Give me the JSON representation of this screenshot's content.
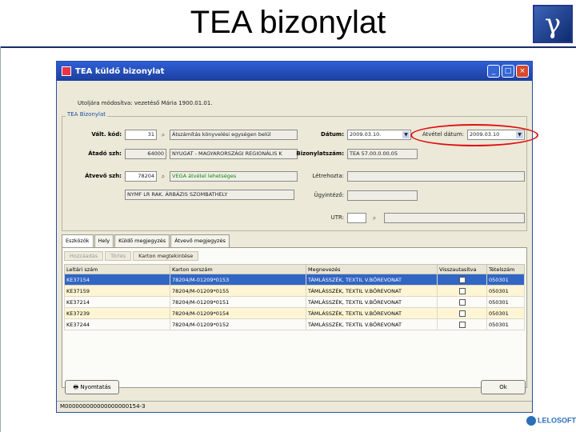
{
  "slide": {
    "title": "TEA bizonylat",
    "footer_brand": "LELOSOFT"
  },
  "window": {
    "title": "TEA küldő bizonylat",
    "user_line": "Utoljára módosítva: vezetéső Mária 1900.01.01.",
    "fieldset_label": "TEA Bizonylat",
    "minimize": "_",
    "maximize": "□",
    "close": "×"
  },
  "form": {
    "valt_kod_label": "Vált. kód:",
    "valt_kod_value": "31",
    "valt_kod_desc": "Átszámítás könyvelési egységen belül",
    "atado_szh_label": "Átadó szh:",
    "atado_szh_value": "64000",
    "atado_szh_desc": "NYUGAT - MAGYARORSZÁGI REGIONÁLIS K",
    "atvevo_szh_label": "Átvevő szh:",
    "atvevo_szh_value": "78204",
    "atvevo_szh_desc": "VEGA átvétel lehetséges",
    "atvevo_szh_desc2": "NYMF LR RAK. ÁRBÁZIS SZOMBATHELY",
    "datum_label": "Dátum:",
    "datum_value": "2009.03.10.",
    "atvetel_datum_label": "Átvétel dátum:",
    "atvetel_datum_value": "2009.03.10",
    "bizonylatszam_label": "Bizonylatszám:",
    "bizonylatszam_value": "TEA 57.00.0.00.05",
    "letrehozta_label": "Létrehozta:",
    "letrehozta_value": "",
    "ugyintezo_label": "Ügyintéző:",
    "ugyintezo_value": "",
    "utr_label": "UTR:",
    "utr_value": ""
  },
  "tabs": [
    "Eszközök",
    "Hely",
    "Küldő megjegyzés",
    "Átvevő megjegyzés"
  ],
  "toolbar": {
    "add": "Hozzáadás",
    "delete": "Törlés",
    "card_view": "Karton megtekintése"
  },
  "table": {
    "columns": [
      "Leltári szám",
      "Karton sorszám",
      "Megnevezés",
      "Visszautasítva",
      "Tételszám"
    ],
    "rows": [
      {
        "leltari": "KE37154",
        "karton": "78204/M-01209*0153",
        "megnevezes": "TÁMLÁSSZÉK, TEXTIL V.BŐREVONAT",
        "szam": "050301"
      },
      {
        "leltari": "KE37159",
        "karton": "78204/M-01209*0155",
        "megnevezes": "TÁMLÁSSZÉK, TEXTIL V.BŐREVONAT",
        "szam": "050301"
      },
      {
        "leltari": "KE37214",
        "karton": "78204/M-01209*0151",
        "megnevezes": "TÁMLÁSSZÉK, TEXTIL V.BŐREVONAT",
        "szam": "050301"
      },
      {
        "leltari": "KE37239",
        "karton": "78204/M-01209*0154",
        "megnevezes": "TÁMLÁSSZÉK, TEXTIL V.BŐREVONAT",
        "szam": "050301"
      },
      {
        "leltari": "KE37244",
        "karton": "78204/M-01209*0152",
        "megnevezes": "TÁMLÁSSZÉK, TEXTIL V.BŐREVONAT",
        "szam": "050301"
      }
    ]
  },
  "buttons": {
    "print": "Nyomtatás",
    "ok": "Ok"
  },
  "status": "M000000000000000000154-3"
}
